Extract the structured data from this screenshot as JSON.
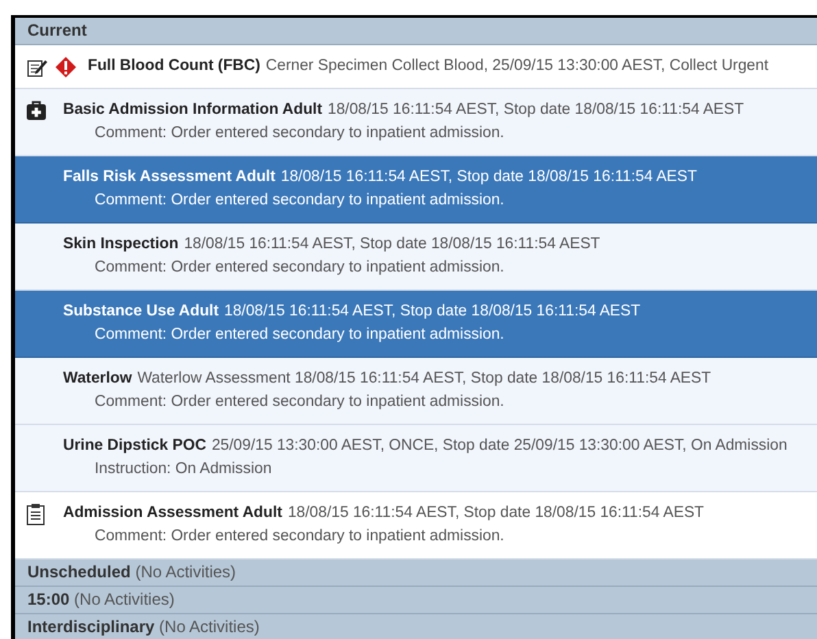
{
  "groups": [
    {
      "title": "Current",
      "items": [
        {
          "kind": "specimen",
          "name": "Full Blood Count (FBC)",
          "details": "Cerner Specimen Collect Blood, 25/09/15 13:30:00 AEST, Collect Urgent",
          "selected": false
        },
        {
          "kind": "kit",
          "name": "Basic Admission Information Adult",
          "details": "18/08/15 16:11:54 AEST, Stop date 18/08/15 16:11:54 AEST",
          "note": "Comment: Order entered secondary to inpatient admission.",
          "selected": false
        },
        {
          "kind": "task",
          "name": "Falls Risk Assessment Adult",
          "details": "18/08/15 16:11:54 AEST, Stop date 18/08/15 16:11:54 AEST",
          "note": "Comment: Order entered secondary to inpatient admission.",
          "selected": true
        },
        {
          "kind": "task",
          "name": "Skin Inspection",
          "details": "18/08/15 16:11:54 AEST, Stop date 18/08/15 16:11:54 AEST",
          "note": "Comment: Order entered secondary to inpatient admission.",
          "selected": false
        },
        {
          "kind": "task",
          "name": "Substance Use Adult",
          "details": "18/08/15 16:11:54 AEST, Stop date 18/08/15 16:11:54 AEST",
          "note": "Comment: Order entered secondary to inpatient admission.",
          "selected": true
        },
        {
          "kind": "task",
          "name": "Waterlow",
          "details": "Waterlow Assessment 18/08/15 16:11:54 AEST, Stop date 18/08/15 16:11:54 AEST",
          "note": "Comment: Order entered secondary to inpatient admission.",
          "selected": false
        },
        {
          "kind": "task",
          "name": "Urine Dipstick POC",
          "details": "25/09/15 13:30:00 AEST, ONCE, Stop date 25/09/15 13:30:00 AEST, On Admission",
          "note": "Instruction: On Admission",
          "selected": false
        },
        {
          "kind": "clipboard",
          "name": "Admission Assessment Adult",
          "details": "18/08/15 16:11:54 AEST, Stop date 18/08/15 16:11:54 AEST",
          "note": "Comment: Order entered secondary to inpatient admission.",
          "selected": false
        }
      ]
    },
    {
      "title": "Unscheduled",
      "note": "(No Activities)"
    },
    {
      "title": "15:00",
      "note": "(No Activities)"
    },
    {
      "title": "Interdisciplinary",
      "note": "(No Activities)"
    }
  ]
}
